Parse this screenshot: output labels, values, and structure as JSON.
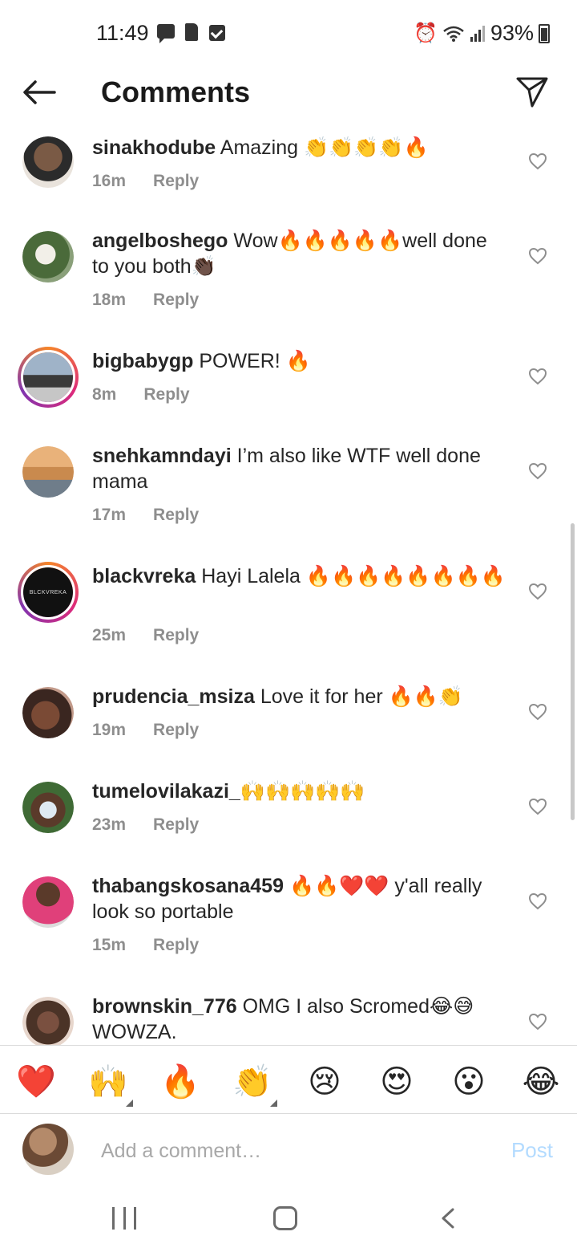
{
  "status_bar": {
    "time": "11:49",
    "battery": "93%"
  },
  "header": {
    "title": "Comments"
  },
  "comments": [
    {
      "username": "sinakhodube",
      "text": "Amazing 👏👏👏👏🔥",
      "time": "16m",
      "reply": "Reply",
      "avatar_color": "#7a5a45"
    },
    {
      "username": "angelboshego",
      "text": "Wow🔥🔥🔥🔥🔥well done to you both👏🏿",
      "time": "18m",
      "reply": "Reply",
      "avatar_color": "#4a6a3a"
    },
    {
      "username": "bigbabygp",
      "text": "POWER! 🔥",
      "time": "8m",
      "reply": "Reply",
      "avatar_color": "#5e6e86"
    },
    {
      "username": "snehkamndayi",
      "text": "I’m also like WTF well done mama",
      "time": "17m",
      "reply": "Reply",
      "avatar_color": "#c98a4e"
    },
    {
      "username": "blackvreka",
      "text": "Hayi Lalela 🔥🔥🔥🔥🔥🔥🔥🔥",
      "time": "25m",
      "reply": "Reply",
      "avatar_color": "#111111",
      "avatar_text": "BLCKVREKA"
    },
    {
      "username": "prudencia_msiza",
      "text": "Love it for her 🔥🔥👏",
      "time": "19m",
      "reply": "Reply",
      "avatar_color": "#5a3a2e"
    },
    {
      "username": "tumelovilakazi_",
      "text": "🙌🙌🙌🙌🙌",
      "time": "23m",
      "reply": "Reply",
      "avatar_color": "#3f6a35"
    },
    {
      "username": "thabangskosana459",
      "text": "🔥🔥❤️❤️ y'all really look so portable",
      "time": "15m",
      "reply": "Reply",
      "avatar_color": "#e0407a"
    },
    {
      "username": "brownskin_776",
      "text": "OMG I also Scromed😂😅 WOWZA.",
      "time": "",
      "reply": "",
      "avatar_color": "#4b3327"
    }
  ],
  "reactions": [
    "❤️",
    "🙌",
    "🔥",
    "👏",
    "😢",
    "😍",
    "😮",
    "😂"
  ],
  "input": {
    "placeholder": "Add a comment…",
    "post_label": "Post"
  },
  "colors": {
    "accent": "#0095f6",
    "post_disabled": "#b3dbff",
    "meta": "#8e8e8e"
  }
}
